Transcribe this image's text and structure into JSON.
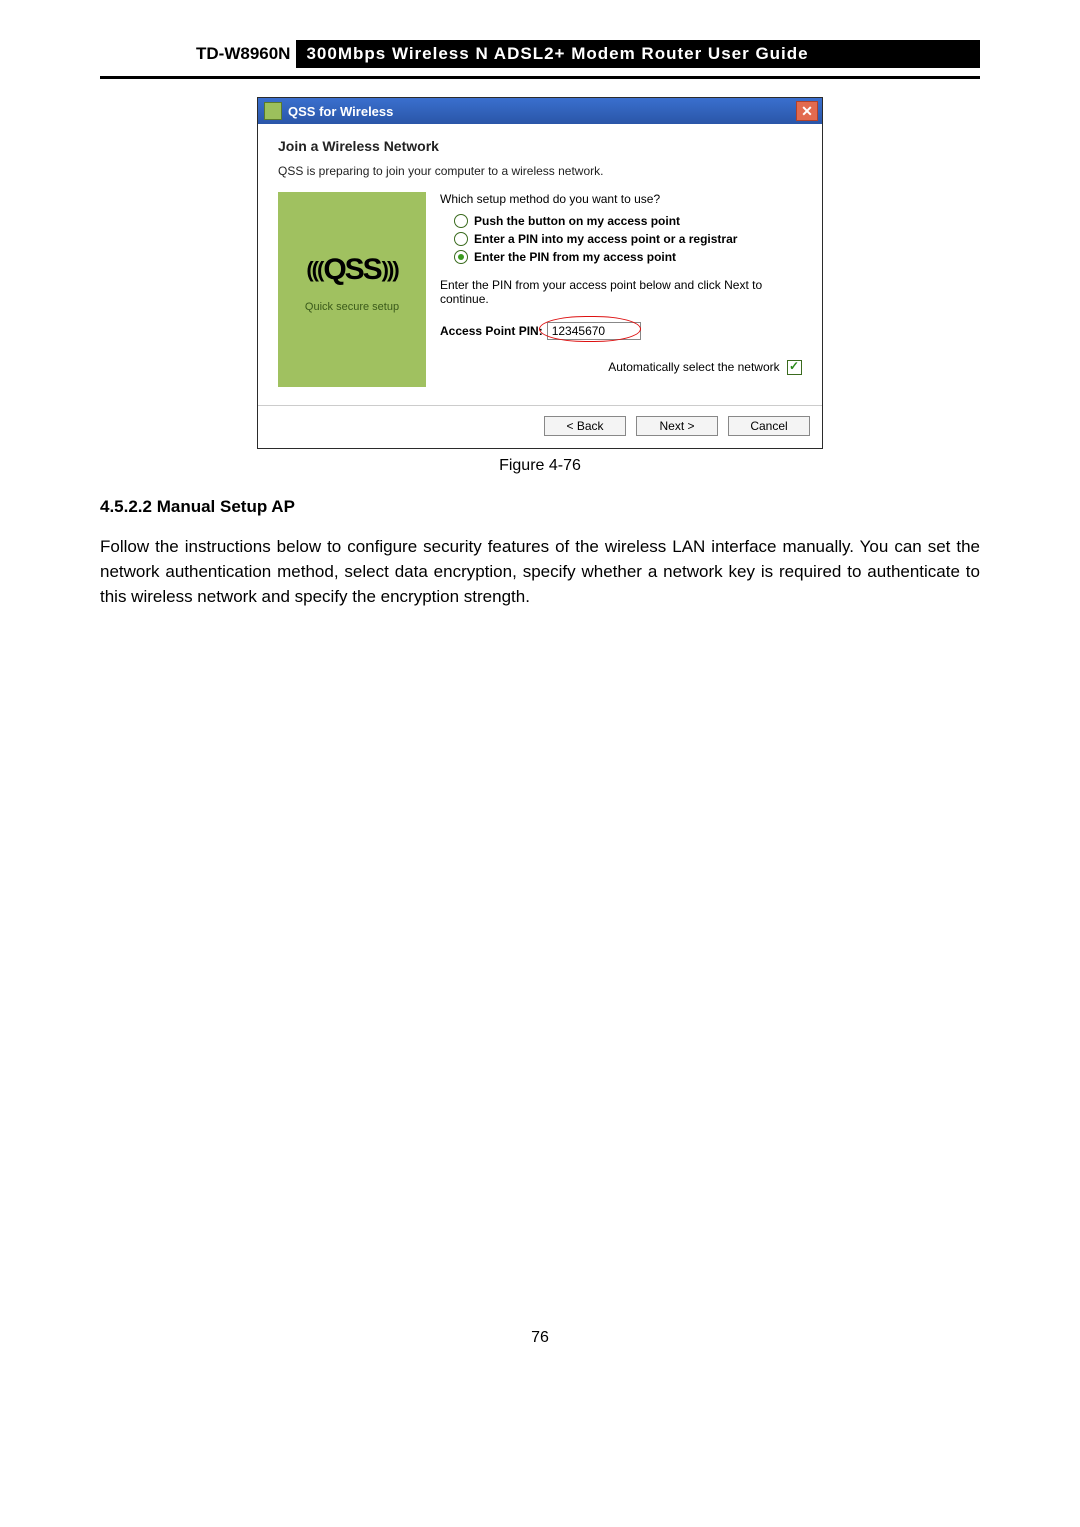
{
  "header": {
    "model": "TD-W8960N",
    "title": "300Mbps  Wireless  N  ADSL2+  Modem  Router  User  Guide"
  },
  "dialog": {
    "title": "QSS for Wireless",
    "heading": "Join a Wireless Network",
    "subtext": "QSS is preparing to join your computer to a wireless network.",
    "panel": {
      "logo": "QSS",
      "caption": "Quick secure setup"
    },
    "question": "Which setup method do you want to use?",
    "options": [
      "Push the button on my access point",
      "Enter a PIN into my access point or a registrar",
      "Enter the PIN from my access point"
    ],
    "instruction": "Enter the PIN from your access point below and click Next to continue.",
    "pin_label": "Access Point PIN:",
    "pin_value": "12345670",
    "auto_select": "Automatically select the network",
    "buttons": {
      "back": "< Back",
      "next": "Next >",
      "cancel": "Cancel"
    }
  },
  "figure_caption": "Figure 4-76",
  "section": {
    "number_title": "4.5.2.2   Manual Setup AP",
    "paragraph": "Follow the instructions below to configure security features of the wireless LAN interface manually. You can set the network authentication method, select data encryption, specify whether a network key is required to authenticate to this wireless network and specify the encryption strength."
  },
  "page_number": "76"
}
